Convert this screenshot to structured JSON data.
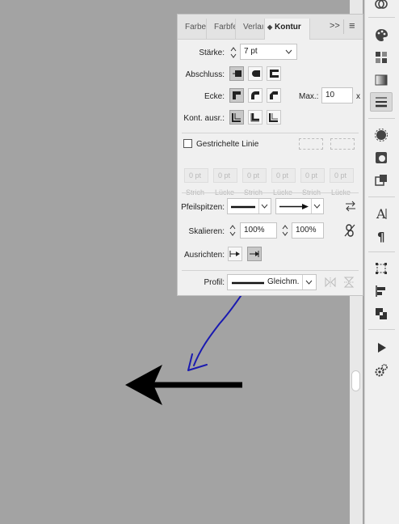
{
  "panel": {
    "tabs": [
      "Farbe",
      "Farbfe",
      "Verlaı",
      "Kontur"
    ],
    "labels": {
      "staerke": "Stärke:",
      "abschluss": "Abschluss:",
      "ecke": "Ecke:",
      "max": "Max.:",
      "kont": "Kont. ausr.:",
      "gestrichelt": "Gestrichelte Linie",
      "pfeilspitzen": "Pfeilspitzen:",
      "skalieren": "Skalieren:",
      "ausrichten": "Ausrichten:",
      "profil": "Profil:"
    },
    "values": {
      "staerke": "7 pt",
      "max": "10",
      "max_unit": "x",
      "scale_start": "100%",
      "scale_end": "100%",
      "profile": "Gleichm."
    },
    "dash": {
      "pt": "0 pt",
      "labels": [
        "Strich",
        "Lücke",
        "Strich",
        "Lücke",
        "Strich",
        "Lücke"
      ]
    },
    "checkbox_checked": false
  },
  "annotation": {
    "color": "#1a1ab0"
  },
  "canvas": {
    "arrow_color": "#000000"
  }
}
